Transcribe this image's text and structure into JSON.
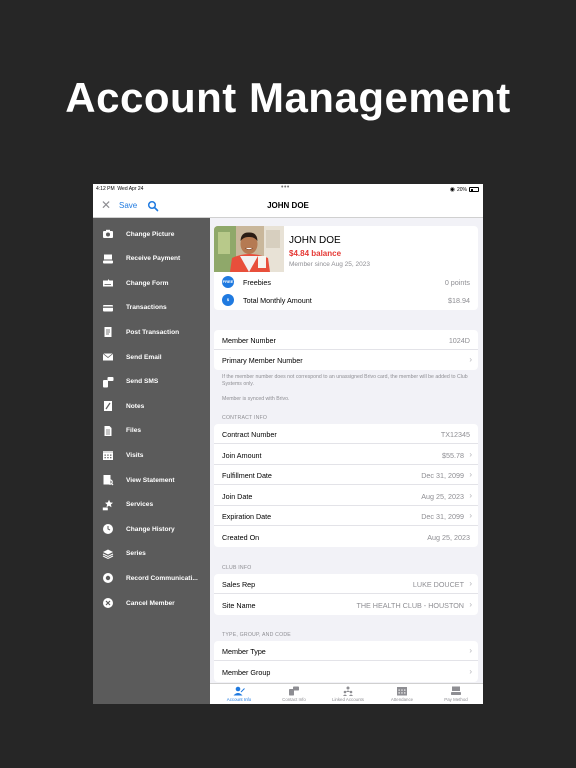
{
  "hero_title": "Account Management",
  "status": {
    "time": "4:12 PM",
    "date": "Wed Apr 24",
    "battery": "20%"
  },
  "nav": {
    "save": "Save",
    "title": "JOHN DOE"
  },
  "sidebar": {
    "items": [
      {
        "label": "Change Picture",
        "icon": "camera-icon"
      },
      {
        "label": "Receive Payment",
        "icon": "payment-icon"
      },
      {
        "label": "Change Form",
        "icon": "form-icon"
      },
      {
        "label": "Transactions",
        "icon": "card-icon"
      },
      {
        "label": "Post Transaction",
        "icon": "receipt-icon"
      },
      {
        "label": "Send Email",
        "icon": "envelope-icon"
      },
      {
        "label": "Send SMS",
        "icon": "phone-icon"
      },
      {
        "label": "Notes",
        "icon": "notes-icon"
      },
      {
        "label": "Files",
        "icon": "file-icon"
      },
      {
        "label": "Visits",
        "icon": "calendar-icon"
      },
      {
        "label": "View Statement",
        "icon": "statement-icon"
      },
      {
        "label": "Services",
        "icon": "services-icon"
      },
      {
        "label": "Change History",
        "icon": "clock-icon"
      },
      {
        "label": "Series",
        "icon": "layers-icon"
      },
      {
        "label": "Record Communicati...",
        "icon": "record-icon"
      },
      {
        "label": "Cancel Member",
        "icon": "cancel-icon"
      }
    ]
  },
  "profile": {
    "name": "JOHN DOE",
    "balance": "$4.84 balance",
    "since": "Member since Aug 25, 2023",
    "freebies_badge": "FREE",
    "freebies_label": "Freebies",
    "freebies_value": "0 points",
    "monthly_label": "Total Monthly Amount",
    "monthly_value": "$18.94"
  },
  "member": {
    "number_label": "Member Number",
    "number_value": "1024D",
    "primary_label": "Primary Member Number",
    "note1": "If the member number does not correspond to an unassigned Brivo card, the member will be added to Club Systems only.",
    "note2": "Member is synced with Brivo."
  },
  "contract": {
    "header": "CONTRACT INFO",
    "rows": [
      {
        "label": "Contract Number",
        "value": "TX12345"
      },
      {
        "label": "Join Amount",
        "value": "$55.78"
      },
      {
        "label": "Fulfillment Date",
        "value": "Dec 31, 2099"
      },
      {
        "label": "Join Date",
        "value": "Aug 25, 2023"
      },
      {
        "label": "Expiration Date",
        "value": "Dec 31, 2099"
      },
      {
        "label": "Created On",
        "value": "Aug 25, 2023"
      }
    ]
  },
  "club": {
    "header": "CLUB INFO",
    "rows": [
      {
        "label": "Sales Rep",
        "value": "LUKE DOUCET"
      },
      {
        "label": "Site Name",
        "value": "THE HEALTH CLUB - HOUSTON"
      }
    ]
  },
  "type": {
    "header": "TYPE, GROUP, AND CODE",
    "rows": [
      {
        "label": "Member Type",
        "value": ""
      },
      {
        "label": "Member Group",
        "value": ""
      }
    ]
  },
  "tabs": [
    {
      "label": "Account Info",
      "icon": "account-info-icon",
      "active": true
    },
    {
      "label": "Contact Info",
      "icon": "contact-info-icon",
      "active": false
    },
    {
      "label": "Linked Accounts",
      "icon": "linked-accounts-icon",
      "active": false
    },
    {
      "label": "Attendance",
      "icon": "attendance-icon",
      "active": false
    },
    {
      "label": "Pay Method",
      "icon": "pay-method-icon",
      "active": false
    }
  ],
  "colors": {
    "accent": "#1f7ae0",
    "balance": "#e53935",
    "sidebar": "#5b5b5b",
    "background": "#262626"
  }
}
